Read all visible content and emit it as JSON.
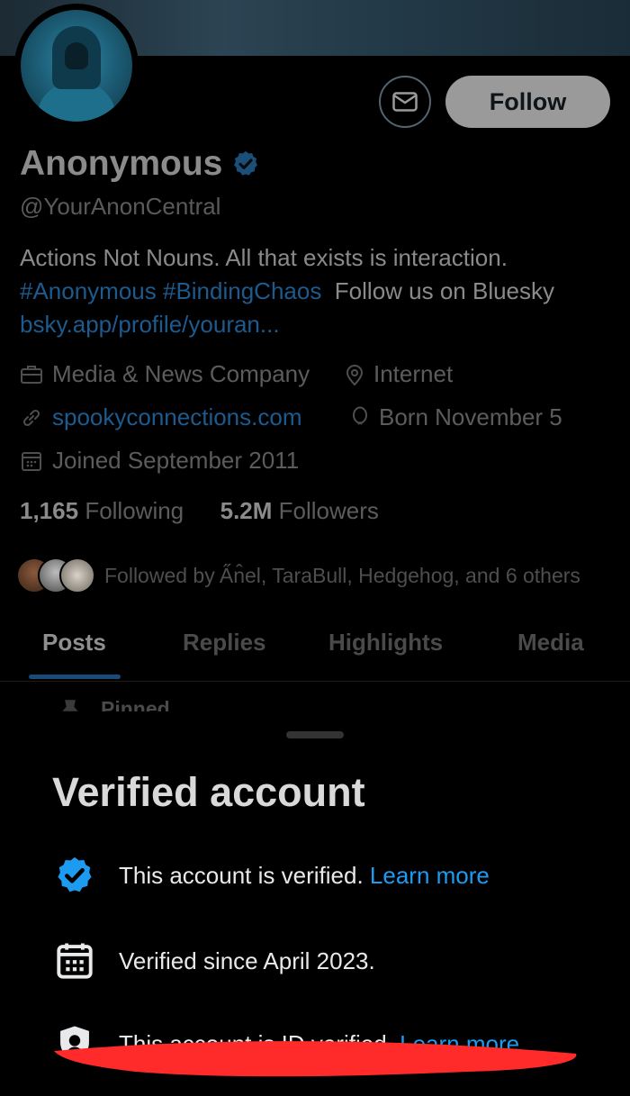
{
  "profile": {
    "name": "Anonymous",
    "handle": "@YourAnonCentral",
    "bio_text": "Actions Not Nouns. All that exists is interaction.",
    "bio_hashtags": "#Anonymous #BindingChaos",
    "bio_after": "Follow us on Bluesky",
    "bio_link": "bsky.app/profile/youran...",
    "category": "Media & News Company",
    "location": "Internet",
    "website": "spookyconnections.com",
    "birthday": "Born November 5",
    "joined": "Joined September 2011"
  },
  "stats": {
    "following_count": "1,165",
    "following_label": "Following",
    "followers_count": "5.2M",
    "followers_label": "Followers",
    "followed_by": "Followed by A̋n̂el, TaraBull, Hedgehog, and 6 others"
  },
  "actions": {
    "follow_label": "Follow"
  },
  "tabs": [
    {
      "label": "Posts"
    },
    {
      "label": "Replies"
    },
    {
      "label": "Highlights"
    },
    {
      "label": "Media"
    }
  ],
  "pinned_label": "Pinned",
  "sheet": {
    "title": "Verified account",
    "rows": [
      {
        "text": "This account is verified.",
        "link": "Learn more"
      },
      {
        "text": "Verified since April 2023.",
        "link": ""
      },
      {
        "text": "This account is ID verified.",
        "link": "Learn more"
      }
    ]
  },
  "colors": {
    "accent": "#1d9bf0",
    "annotation": "#ff2a2a"
  }
}
